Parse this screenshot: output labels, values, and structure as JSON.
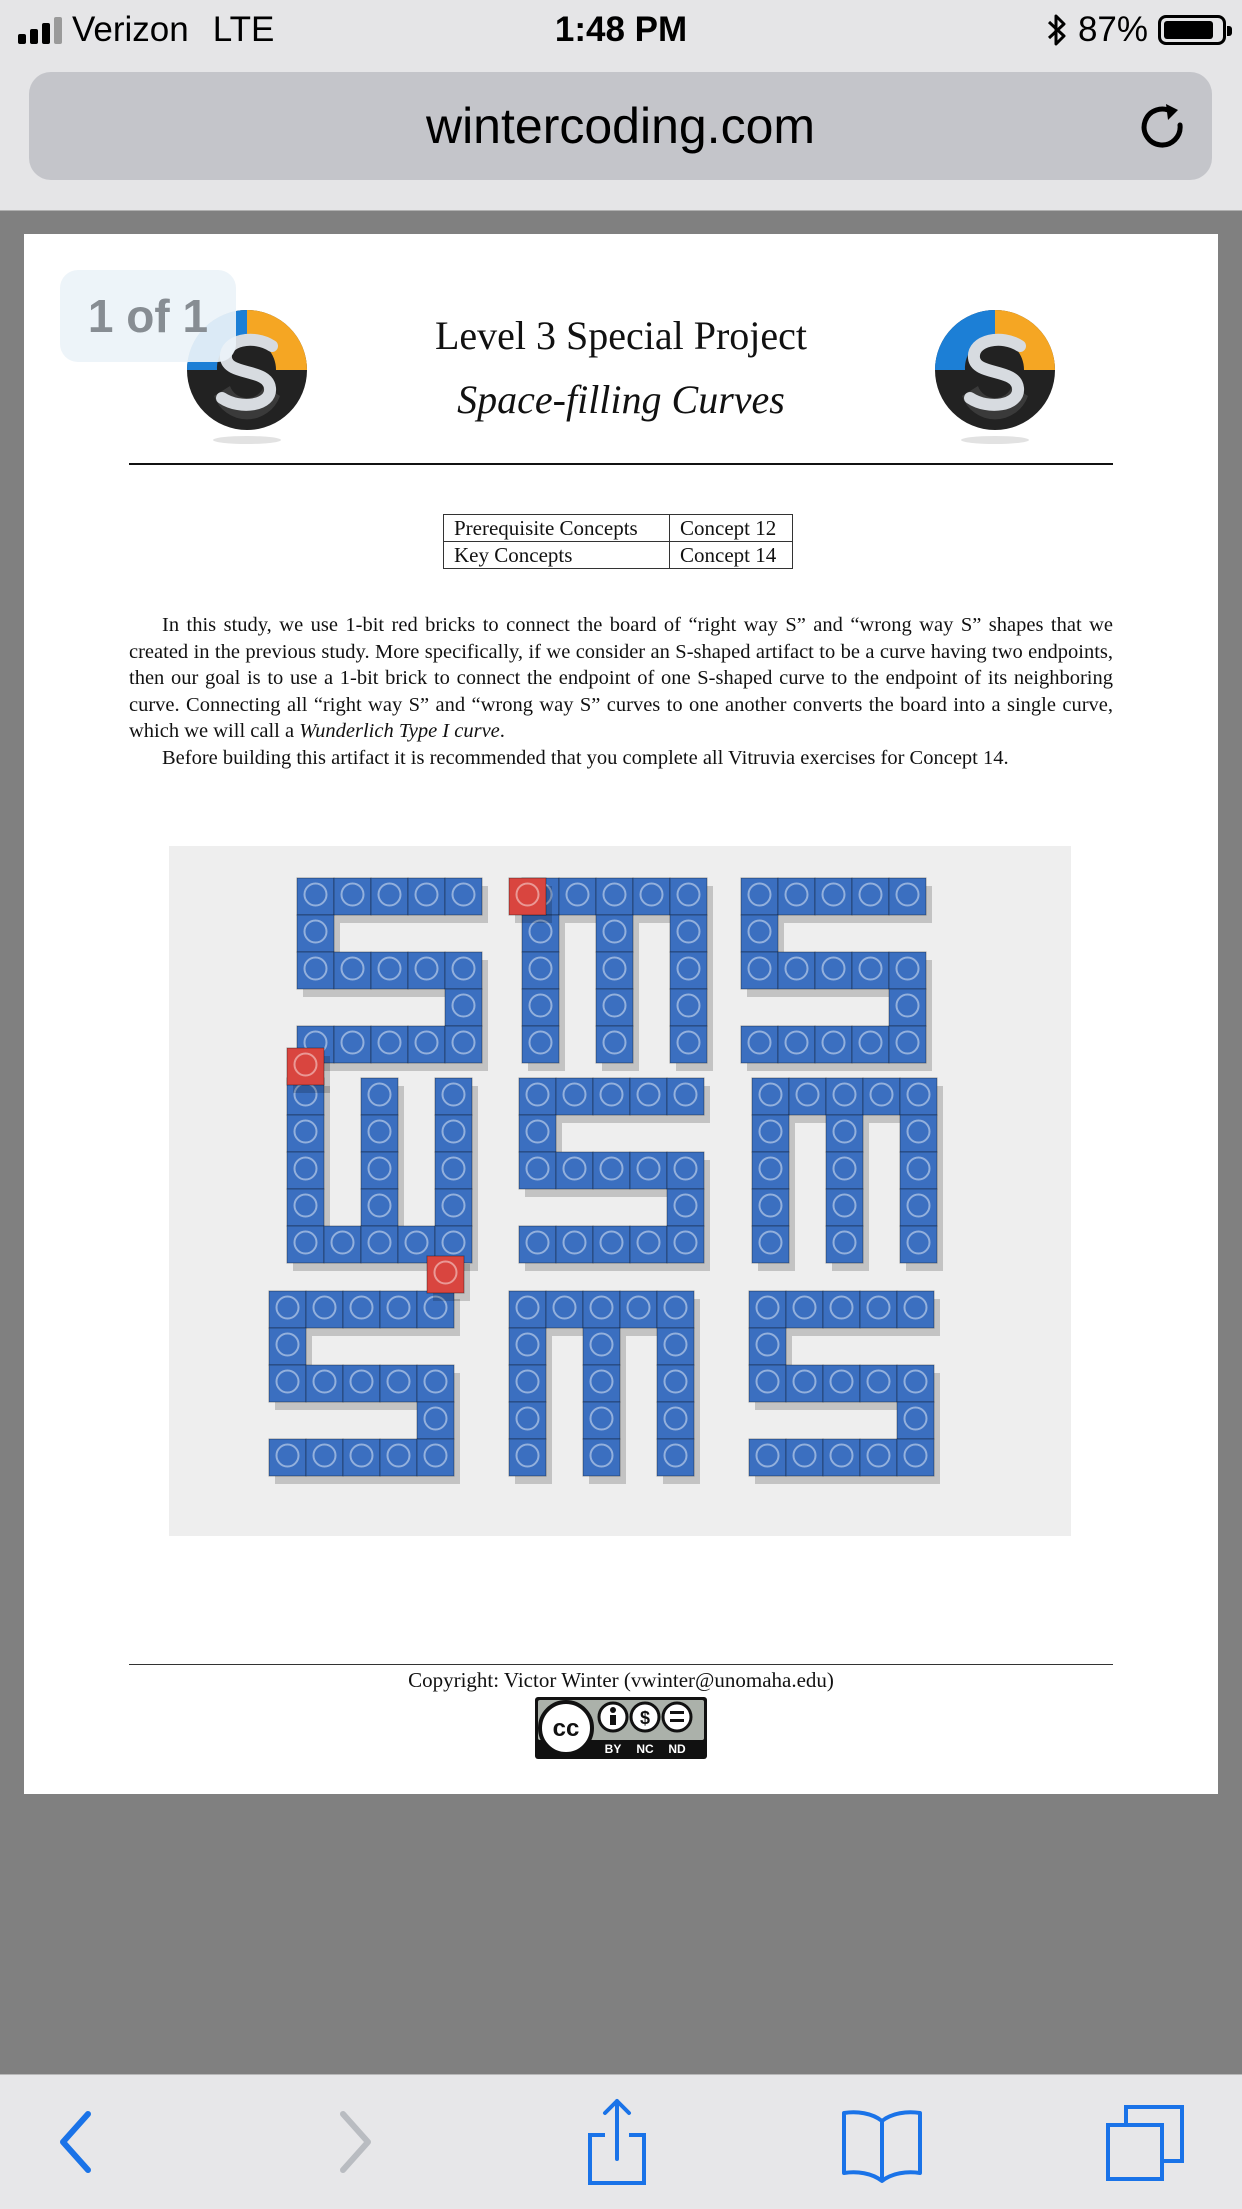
{
  "status_bar": {
    "carrier": "Verizon",
    "network": "LTE",
    "time": "1:48 PM",
    "battery": "87%",
    "battery_level": 0.87,
    "signal_bars_filled": 3,
    "signal_bars_total": 4
  },
  "browser": {
    "url": "wintercoding.com",
    "reload_icon": "reload-icon"
  },
  "document": {
    "page_indicator": "1 of 1",
    "title": "Level 3 Special Project",
    "subtitle": "Space-filling Curves",
    "concepts_table": [
      {
        "label": "Prerequisite Concepts",
        "value": "Concept 12"
      },
      {
        "label": "Key Concepts",
        "value": "Concept 14"
      }
    ],
    "paragraph1_lead": "In this study, we use 1-bit red bricks to connect the board of “right way S” and “wrong way S” shapes that we created in the previous study. More specifically, if we consider an S-shaped artifact to be a curve having two endpoints, then our goal is to use a 1-bit brick to connect the endpoint of one S-shaped curve to the endpoint of its neighboring curve. Connecting all “right way S” and “wrong way S” curves to one another converts the board into a single curve, which we will call a",
    "paragraph1_emph": "Wunderlich Type I curve",
    "paragraph1_end": ".",
    "paragraph2": "Before building this artifact it is recommended that you complete all Vitruvia exercises for Concept 14.",
    "copyright": "Copyright: Victor Winter (vwinter@unomaha.edu)",
    "license_badge_labels": [
      "BY",
      "NC",
      "ND"
    ],
    "license_badge_mark": "cc"
  },
  "toolbar": {
    "buttons": [
      "back-icon",
      "forward-icon",
      "share-icon",
      "bookmarks-icon",
      "tabs-icon"
    ]
  },
  "colors": {
    "accent": "#1a73e8",
    "brick_blue": "#3b6fc0",
    "brick_red": "#d9453f",
    "logo_blue": "#1c7fd6",
    "logo_orange": "#f5a623"
  }
}
